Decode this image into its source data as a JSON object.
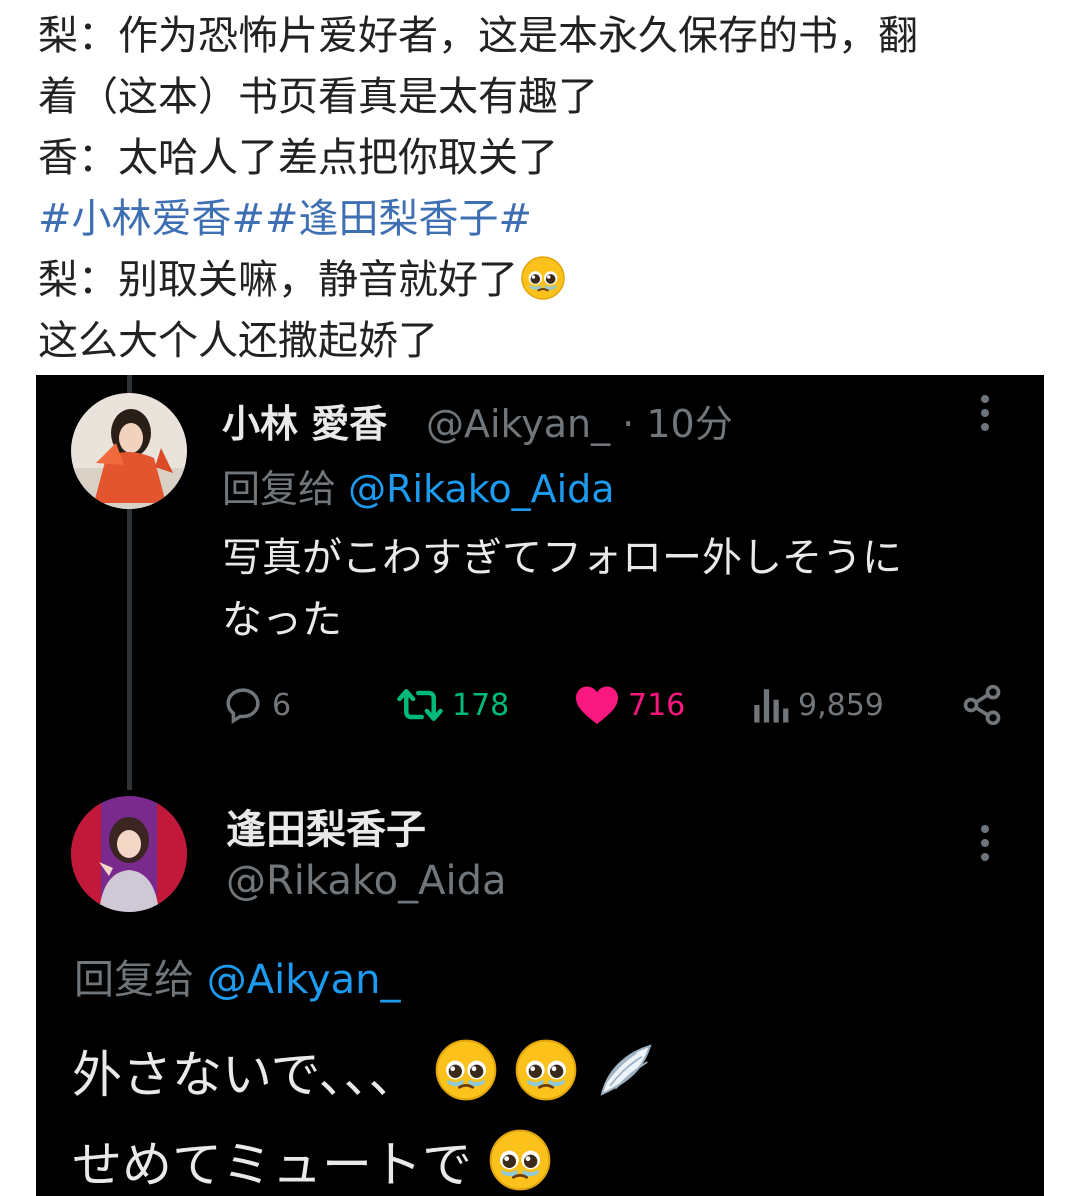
{
  "post": {
    "lines": [
      "梨：作为恐怖片爱好者，这是本永久保存的书，翻",
      "着（这本）书页看真是太有趣了",
      "香：太哈人了差点把你取关了"
    ],
    "hashtags": "#小林爱香##逢田梨香子#",
    "line5": "梨：别取关嘛，静音就好了",
    "line6": "这么大个人还撒起娇了"
  },
  "tweet1": {
    "display_name": "小林 愛香",
    "handle": "@Aikyan_",
    "dot": "·",
    "time": "10分",
    "reply_prefix": "回复给",
    "reply_to": "@Rikako_Aida",
    "body_line1": "写真がこわすぎてフォロー外しそうに",
    "body_line2": "なった",
    "replies": "6",
    "retweets": "178",
    "likes": "716",
    "views": "9,859"
  },
  "tweet2": {
    "display_name": "逢田梨香子",
    "handle": "@Rikako_Aida",
    "reply_prefix": "回复给",
    "reply_to": "@Aikyan_",
    "body_line1": "外さないで、、、",
    "body_line2": "せめてミュートで"
  },
  "colors": {
    "hashtag": "#3f6fb3",
    "link_blue": "#1d9bf0",
    "like_pink": "#f91880",
    "retweet_green": "#00ba7c",
    "muted_grey": "#71767b"
  },
  "icons": [
    "pleading-face-emoji",
    "more-icon",
    "reply-icon",
    "retweet-icon",
    "like-icon",
    "views-icon",
    "share-icon",
    "wing-emoji"
  ]
}
